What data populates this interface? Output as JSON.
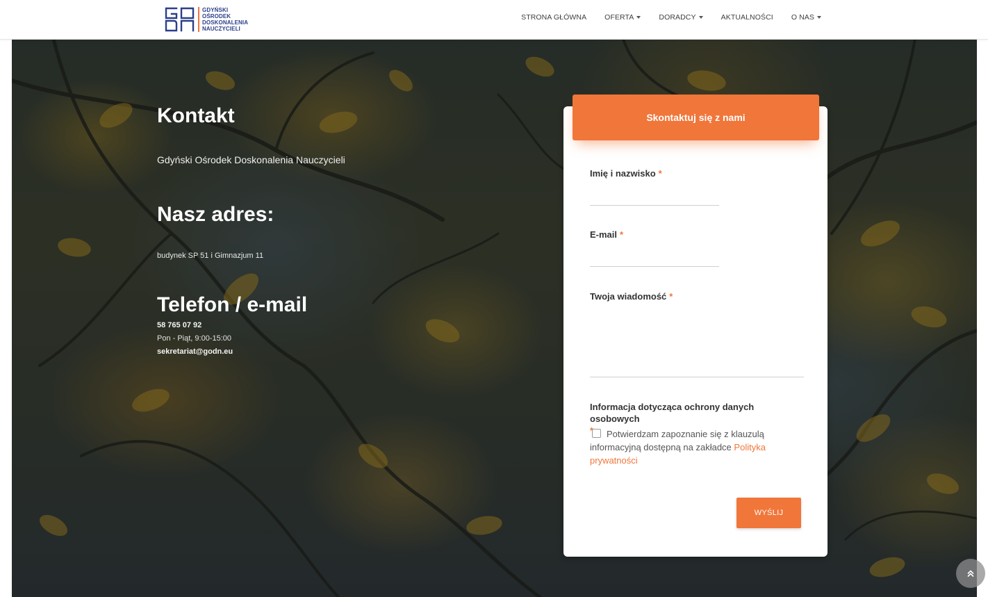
{
  "logo": {
    "monogram_top": "GO",
    "monogram_bottom": "DN",
    "lines": [
      "GDYŃSKI",
      "OŚRODEK",
      "DOSKONALENIA",
      "NAUCZYCIELI"
    ]
  },
  "nav": {
    "items": [
      {
        "label": "STRONA GŁÓWNA",
        "dropdown": false
      },
      {
        "label": "OFERTA",
        "dropdown": true
      },
      {
        "label": "DORADCY",
        "dropdown": true
      },
      {
        "label": "AKTUALNOŚCI",
        "dropdown": false
      },
      {
        "label": "O NAS",
        "dropdown": true
      }
    ]
  },
  "contact": {
    "heading": "Kontakt",
    "org_name": "Gdyński Ośrodek Doskonalenia Nauczycieli",
    "address_heading": "Nasz adres:",
    "address_line": "budynek SP 51 i Gimnazjum 11",
    "phone_heading": "Telefon / e-mail",
    "phone": "58 765 07 92",
    "hours": "Pon - Piąt, 9:00-15:00",
    "email": "sekretariat@godn.eu"
  },
  "form": {
    "title": "Skontaktuj się z nami",
    "name_label": "Imię i nazwisko",
    "email_label": "E-mail",
    "message_label": "Twoja wiadomość",
    "required_marker": "*",
    "privacy_label": "Informacja dotycząca ochrony danych osobowych",
    "consent_text": "Potwierdzam zapoznanie się z klauzulą informacyjną dostępną na zakładce",
    "privacy_link": "Polityka prywatności",
    "consent_checked": false,
    "submit_label": "WYŚLIJ"
  },
  "colors": {
    "accent": "#f0763a",
    "logo_blue": "#2b3f8a"
  },
  "icons": {
    "scroll_top": "double-chevron-up-icon"
  }
}
